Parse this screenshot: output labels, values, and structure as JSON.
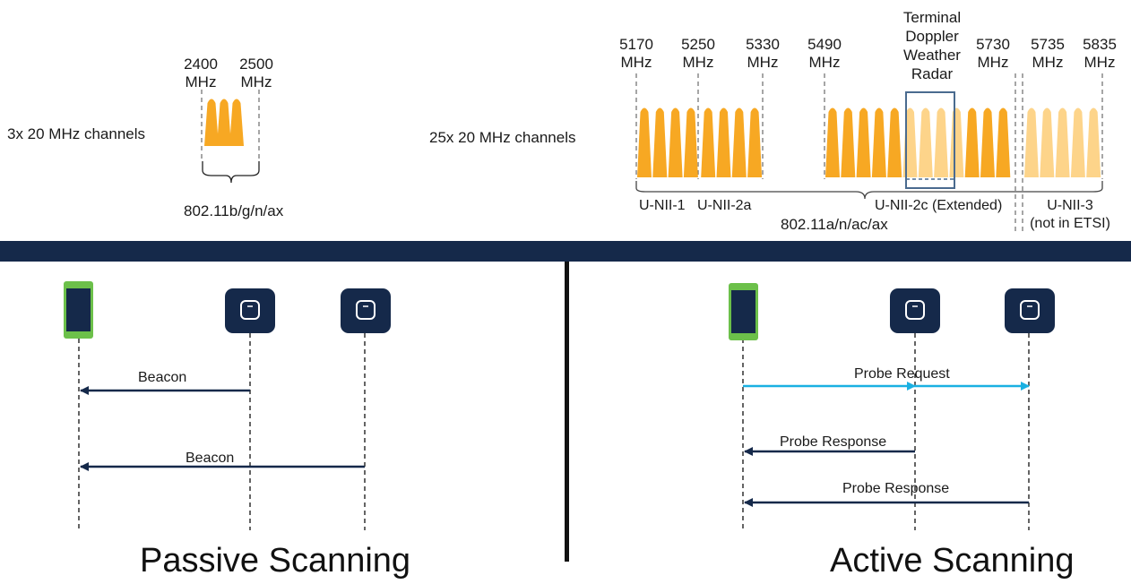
{
  "colors": {
    "channel": "#f7a823",
    "channel_light": "#fdd48a",
    "navy": "#15294a",
    "probe_request": "#1ab0e2",
    "phone_green": "#6cc04a",
    "dashed": "#777777",
    "radar_box": "#4a6b8f"
  },
  "band24": {
    "freq_2400": "2400",
    "freq_2500": "2500",
    "unit": "MHz",
    "channels_label": "3x 20 MHz channels",
    "standard": "802.11b/g/n/ax"
  },
  "band5": {
    "freqs": [
      "5170",
      "5250",
      "5330",
      "5490",
      "5730",
      "5735",
      "5835"
    ],
    "unit": "MHz",
    "radar_line1": "Terminal",
    "radar_line2": "Doppler",
    "radar_line3": "Weather",
    "radar_line4": "Radar",
    "channels_label": "25x 20 MHz channels",
    "unii1": "U-NII-1",
    "unii2a": "U-NII-2a",
    "unii2c": "U-NII-2c (Extended)",
    "unii3": "U-NII-3",
    "unii3_note": "(not in ETSI)",
    "standard": "802.11a/n/ac/ax"
  },
  "passive": {
    "title": "Passive Scanning",
    "msg1": "Beacon",
    "msg2": "Beacon"
  },
  "active": {
    "title": "Active Scanning",
    "request": "Probe Request",
    "response1": "Probe Response",
    "response2": "Probe Response"
  },
  "icons": {
    "phone": "smartphone-icon",
    "access_point": "access-point-icon"
  }
}
